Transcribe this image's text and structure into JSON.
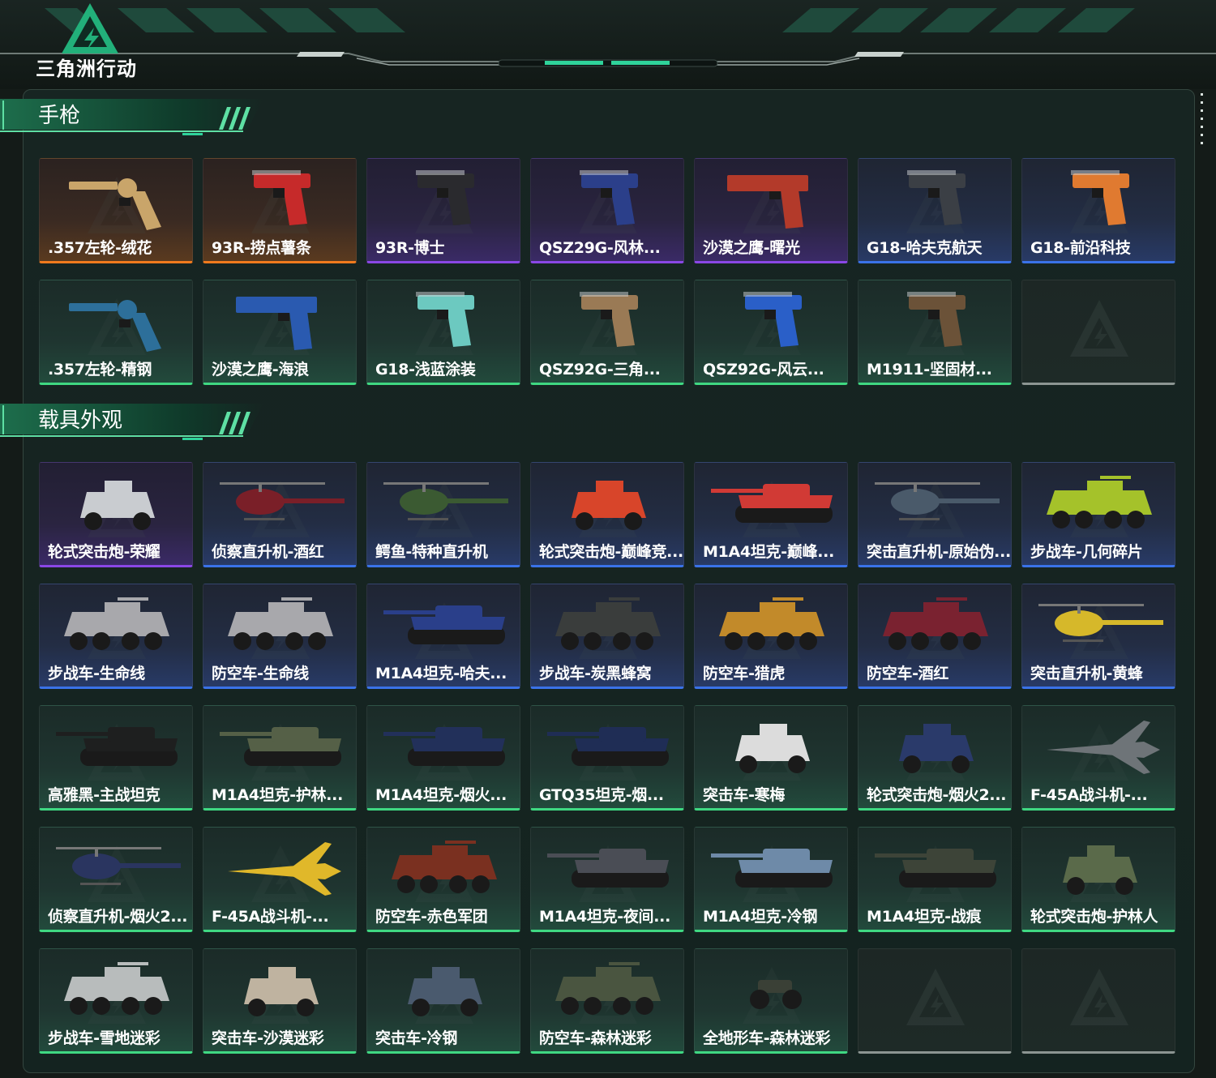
{
  "app": {
    "logo_text": "三角洲行动",
    "logo_icon": "delta-triangle-logo"
  },
  "colors": {
    "orange": "#f07a1d",
    "purple": "#8a47e6",
    "blue": "#3a72e8",
    "green": "#3fd882",
    "empty": "#8c9592",
    "accent": "#2fd39a"
  },
  "sections": [
    {
      "title": "手枪",
      "items": [
        {
          "label": ".357左轮-绒花",
          "rarity": "orange",
          "kind": "revolver",
          "tint": "#c9a56a"
        },
        {
          "label": "93R-捞点薯条",
          "rarity": "orange",
          "kind": "pistol",
          "tint": "#c62a2a"
        },
        {
          "label": "93R-博士",
          "rarity": "purple",
          "kind": "pistol",
          "tint": "#2a2a2e"
        },
        {
          "label": "QSZ29G-风林...",
          "rarity": "purple",
          "kind": "pistol",
          "tint": "#2b3f8a"
        },
        {
          "label": "沙漠之鹰-曙光",
          "rarity": "purple",
          "kind": "deagle",
          "tint": "#b33a2a"
        },
        {
          "label": "G18-哈夫克航天",
          "rarity": "blue",
          "kind": "pistol",
          "tint": "#3b3f45"
        },
        {
          "label": "G18-前沿科技",
          "rarity": "blue",
          "kind": "pistol",
          "tint": "#e07a30"
        },
        {
          "label": ".357左轮-精钢",
          "rarity": "green",
          "kind": "revolver",
          "tint": "#2d6f9a"
        },
        {
          "label": "沙漠之鹰-海浪",
          "rarity": "green",
          "kind": "deagle",
          "tint": "#2a5ab0"
        },
        {
          "label": "G18-浅蓝涂装",
          "rarity": "green",
          "kind": "pistol",
          "tint": "#6cc9c0"
        },
        {
          "label": "QSZ92G-三角...",
          "rarity": "green",
          "kind": "pistol",
          "tint": "#9a7a55"
        },
        {
          "label": "QSZ92G-风云...",
          "rarity": "green",
          "kind": "pistol",
          "tint": "#2a5fc8"
        },
        {
          "label": "M1911-坚固材...",
          "rarity": "green",
          "kind": "pistol",
          "tint": "#6b5238"
        },
        {
          "label": "",
          "rarity": "empty",
          "kind": "empty",
          "tint": "#2a3533"
        }
      ]
    },
    {
      "title": "载具外观",
      "items": [
        {
          "label": "轮式突击炮-荣耀",
          "rarity": "purple",
          "kind": "jeep",
          "tint": "#c9ccd0"
        },
        {
          "label": "侦察直升机-酒红",
          "rarity": "blue",
          "kind": "heli",
          "tint": "#7a1f28"
        },
        {
          "label": "鳄鱼-特种直升机",
          "rarity": "blue",
          "kind": "heli",
          "tint": "#3b5a32"
        },
        {
          "label": "轮式突击炮-巅峰竞...",
          "rarity": "blue",
          "kind": "jeep",
          "tint": "#d8452a"
        },
        {
          "label": "M1A4坦克-巅峰...",
          "rarity": "blue",
          "kind": "tank",
          "tint": "#d13a35"
        },
        {
          "label": "突击直升机-原始伪...",
          "rarity": "blue",
          "kind": "heli",
          "tint": "#4a5a6a"
        },
        {
          "label": "步战车-几何碎片",
          "rarity": "blue",
          "kind": "apc",
          "tint": "#a5c22a"
        },
        {
          "label": "步战车-生命线",
          "rarity": "blue",
          "kind": "apc",
          "tint": "#a8a8ac"
        },
        {
          "label": "防空车-生命线",
          "rarity": "blue",
          "kind": "apc",
          "tint": "#a8a8ac"
        },
        {
          "label": "M1A4坦克-哈夫...",
          "rarity": "blue",
          "kind": "tank",
          "tint": "#2a3f8a"
        },
        {
          "label": "步战车-炭黑蜂窝",
          "rarity": "blue",
          "kind": "apc",
          "tint": "#3a3d3c"
        },
        {
          "label": "防空车-猎虎",
          "rarity": "blue",
          "kind": "apc",
          "tint": "#c28a2a"
        },
        {
          "label": "防空车-酒红",
          "rarity": "blue",
          "kind": "apc",
          "tint": "#7a2230"
        },
        {
          "label": "突击直升机-黄蜂",
          "rarity": "blue",
          "kind": "heli",
          "tint": "#d6b82a"
        },
        {
          "label": "高雅黑-主战坦克",
          "rarity": "green",
          "kind": "tank",
          "tint": "#1e1f1f"
        },
        {
          "label": "M1A4坦克-护林...",
          "rarity": "green",
          "kind": "tank",
          "tint": "#556047"
        },
        {
          "label": "M1A4坦克-烟火...",
          "rarity": "green",
          "kind": "tank",
          "tint": "#22305a"
        },
        {
          "label": "GTQ35坦克-烟...",
          "rarity": "green",
          "kind": "tank",
          "tint": "#1f2d55"
        },
        {
          "label": "突击车-寒梅",
          "rarity": "green",
          "kind": "jeep",
          "tint": "#dcdcdc"
        },
        {
          "label": "轮式突击炮-烟火2...",
          "rarity": "green",
          "kind": "jeep",
          "tint": "#2a3a6a"
        },
        {
          "label": "F-45A战斗机-...",
          "rarity": "green",
          "kind": "jet",
          "tint": "#6e7478"
        },
        {
          "label": "侦察直升机-烟火2...",
          "rarity": "green",
          "kind": "heli",
          "tint": "#2a3560"
        },
        {
          "label": "F-45A战斗机-...",
          "rarity": "green",
          "kind": "jet",
          "tint": "#e0b82a"
        },
        {
          "label": "防空车-赤色军团",
          "rarity": "green",
          "kind": "apc",
          "tint": "#7a3020"
        },
        {
          "label": "M1A4坦克-夜间...",
          "rarity": "green",
          "kind": "tank",
          "tint": "#4a4d55"
        },
        {
          "label": "M1A4坦克-冷钢",
          "rarity": "green",
          "kind": "tank",
          "tint": "#6e8aa8"
        },
        {
          "label": "M1A4坦克-战痕",
          "rarity": "green",
          "kind": "tank",
          "tint": "#3d4438"
        },
        {
          "label": "轮式突击炮-护林人",
          "rarity": "green",
          "kind": "jeep",
          "tint": "#5a6a4a"
        },
        {
          "label": "步战车-雪地迷彩",
          "rarity": "green",
          "kind": "apc",
          "tint": "#b8bcbc"
        },
        {
          "label": "突击车-沙漠迷彩",
          "rarity": "green",
          "kind": "jeep",
          "tint": "#bfb3a0"
        },
        {
          "label": "突击车-冷钢",
          "rarity": "green",
          "kind": "jeep",
          "tint": "#4a5a6e"
        },
        {
          "label": "防空车-森林迷彩",
          "rarity": "green",
          "kind": "apc",
          "tint": "#4a5540"
        },
        {
          "label": "全地形车-森林迷彩",
          "rarity": "green",
          "kind": "atv",
          "tint": "#3a4036"
        },
        {
          "label": "",
          "rarity": "empty",
          "kind": "empty",
          "tint": "#2a3533"
        },
        {
          "label": "",
          "rarity": "empty",
          "kind": "empty",
          "tint": "#2a3533"
        }
      ]
    }
  ]
}
